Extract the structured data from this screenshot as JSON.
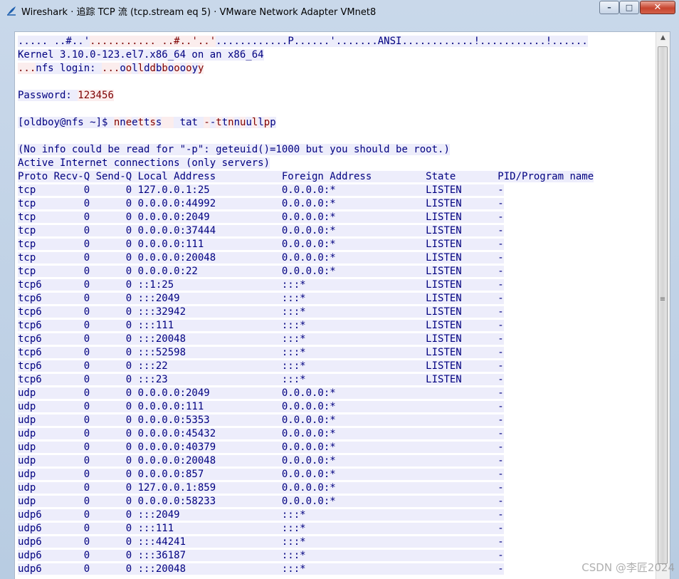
{
  "window": {
    "title": "Wireshark · 追踪 TCP 流 (tcp.stream eq 5) · VMware Network Adapter VMnet8",
    "min_glyph": "–",
    "max_glyph": "□",
    "close_glyph": "✕"
  },
  "colors": {
    "client_text": "#7e0001",
    "client_bg": "#fbeded",
    "server_text": "#000080",
    "server_bg": "#ededfb"
  },
  "segments": [
    {
      "side": "srv",
      "text": "..... ..#..'"
    },
    {
      "side": "cli",
      "text": "........... ..#..'..'"
    },
    {
      "side": "srv",
      "text": "............P......'.......ANSI............!...........!......"
    },
    {
      "side": "brk",
      "text": ""
    },
    {
      "side": "srv",
      "text": "Kernel 3.10.0-123.el7.x86_64 on an x86_64"
    },
    {
      "side": "brk",
      "text": ""
    },
    {
      "side": "cli",
      "text": "..."
    },
    {
      "side": "srv",
      "text": "nfs login: "
    },
    {
      "side": "cli",
      "text": "..."
    },
    {
      "side": "srv",
      "text": "o"
    },
    {
      "side": "cli",
      "text": "o"
    },
    {
      "side": "srv",
      "text": "l"
    },
    {
      "side": "cli",
      "text": "l"
    },
    {
      "side": "srv",
      "text": "d"
    },
    {
      "side": "cli",
      "text": "d"
    },
    {
      "side": "srv",
      "text": "b"
    },
    {
      "side": "cli",
      "text": "b"
    },
    {
      "side": "srv",
      "text": "o"
    },
    {
      "side": "cli",
      "text": "o"
    },
    {
      "side": "srv",
      "text": "o"
    },
    {
      "side": "cli",
      "text": "o"
    },
    {
      "side": "srv",
      "text": "y"
    },
    {
      "side": "cli",
      "text": "y"
    },
    {
      "side": "brk",
      "text": ""
    },
    {
      "side": "brk",
      "text": ""
    },
    {
      "side": "srv",
      "text": "Password: "
    },
    {
      "side": "cli",
      "text": "123456"
    },
    {
      "side": "brk",
      "text": ""
    },
    {
      "side": "brk",
      "text": ""
    },
    {
      "side": "srv",
      "text": "[oldboy@nfs ~]$ "
    },
    {
      "side": "cli",
      "text": "n"
    },
    {
      "side": "srv",
      "text": "n"
    },
    {
      "side": "cli",
      "text": "e"
    },
    {
      "side": "srv",
      "text": "e"
    },
    {
      "side": "cli",
      "text": "t"
    },
    {
      "side": "srv",
      "text": "t"
    },
    {
      "side": "cli",
      "text": "s"
    },
    {
      "side": "srv",
      "text": "s"
    },
    {
      "side": "cli",
      "text": "  "
    },
    {
      "side": "srv",
      "text": " tat "
    },
    {
      "side": "cli",
      "text": "-"
    },
    {
      "side": "srv",
      "text": "-"
    },
    {
      "side": "cli",
      "text": "t"
    },
    {
      "side": "srv",
      "text": "t"
    },
    {
      "side": "cli",
      "text": "n"
    },
    {
      "side": "srv",
      "text": "n"
    },
    {
      "side": "cli",
      "text": "u"
    },
    {
      "side": "srv",
      "text": "u"
    },
    {
      "side": "cli",
      "text": "l"
    },
    {
      "side": "srv",
      "text": "l"
    },
    {
      "side": "cli",
      "text": "p"
    },
    {
      "side": "srv",
      "text": "p"
    },
    {
      "side": "brk",
      "text": ""
    },
    {
      "side": "brk",
      "text": ""
    },
    {
      "side": "srv",
      "text": "(No info could be read for \"-p\": geteuid()=1000 but you should be root.)"
    },
    {
      "side": "brk",
      "text": ""
    },
    {
      "side": "srv",
      "text": "Active Internet connections (only servers)"
    },
    {
      "side": "brk",
      "text": ""
    },
    {
      "side": "srv",
      "text": "Proto Recv-Q Send-Q Local Address           Foreign Address         State       PID/Program name"
    },
    {
      "side": "brk",
      "text": ""
    },
    {
      "side": "srv",
      "text": "tcp        0      0 127.0.0.1:25            0.0.0.0:*               LISTEN      -"
    },
    {
      "side": "brk",
      "text": ""
    },
    {
      "side": "srv",
      "text": "tcp        0      0 0.0.0.0:44992           0.0.0.0:*               LISTEN      -"
    },
    {
      "side": "brk",
      "text": ""
    },
    {
      "side": "srv",
      "text": "tcp        0      0 0.0.0.0:2049            0.0.0.0:*               LISTEN      -"
    },
    {
      "side": "brk",
      "text": ""
    },
    {
      "side": "srv",
      "text": "tcp        0      0 0.0.0.0:37444           0.0.0.0:*               LISTEN      -"
    },
    {
      "side": "brk",
      "text": ""
    },
    {
      "side": "srv",
      "text": "tcp        0      0 0.0.0.0:111             0.0.0.0:*               LISTEN      -"
    },
    {
      "side": "brk",
      "text": ""
    },
    {
      "side": "srv",
      "text": "tcp        0      0 0.0.0.0:20048           0.0.0.0:*               LISTEN      -"
    },
    {
      "side": "brk",
      "text": ""
    },
    {
      "side": "srv",
      "text": "tcp        0      0 0.0.0.0:22              0.0.0.0:*               LISTEN      -"
    },
    {
      "side": "brk",
      "text": ""
    },
    {
      "side": "srv",
      "text": "tcp6       0      0 ::1:25                  :::*                    LISTEN      -"
    },
    {
      "side": "brk",
      "text": ""
    },
    {
      "side": "srv",
      "text": "tcp6       0      0 :::2049                 :::*                    LISTEN      -"
    },
    {
      "side": "brk",
      "text": ""
    },
    {
      "side": "srv",
      "text": "tcp6       0      0 :::32942                :::*                    LISTEN      -"
    },
    {
      "side": "brk",
      "text": ""
    },
    {
      "side": "srv",
      "text": "tcp6       0      0 :::111                  :::*                    LISTEN      -"
    },
    {
      "side": "brk",
      "text": ""
    },
    {
      "side": "srv",
      "text": "tcp6       0      0 :::20048                :::*                    LISTEN      -"
    },
    {
      "side": "brk",
      "text": ""
    },
    {
      "side": "srv",
      "text": "tcp6       0      0 :::52598                :::*                    LISTEN      -"
    },
    {
      "side": "brk",
      "text": ""
    },
    {
      "side": "srv",
      "text": "tcp6       0      0 :::22                   :::*                    LISTEN      -"
    },
    {
      "side": "brk",
      "text": ""
    },
    {
      "side": "srv",
      "text": "tcp6       0      0 :::23                   :::*                    LISTEN      -"
    },
    {
      "side": "brk",
      "text": ""
    },
    {
      "side": "srv",
      "text": "udp        0      0 0.0.0.0:2049            0.0.0.0:*                           -"
    },
    {
      "side": "brk",
      "text": ""
    },
    {
      "side": "srv",
      "text": "udp        0      0 0.0.0.0:111             0.0.0.0:*                           -"
    },
    {
      "side": "brk",
      "text": ""
    },
    {
      "side": "srv",
      "text": "udp        0      0 0.0.0.0:5353            0.0.0.0:*                           -"
    },
    {
      "side": "brk",
      "text": ""
    },
    {
      "side": "srv",
      "text": "udp        0      0 0.0.0.0:45432           0.0.0.0:*                           -"
    },
    {
      "side": "brk",
      "text": ""
    },
    {
      "side": "srv",
      "text": "udp        0      0 0.0.0.0:40379           0.0.0.0:*                           -"
    },
    {
      "side": "brk",
      "text": ""
    },
    {
      "side": "srv",
      "text": "udp        0      0 0.0.0.0:20048           0.0.0.0:*                           -"
    },
    {
      "side": "brk",
      "text": ""
    },
    {
      "side": "srv",
      "text": "udp        0      0 0.0.0.0:857             0.0.0.0:*                           -"
    },
    {
      "side": "brk",
      "text": ""
    },
    {
      "side": "srv",
      "text": "udp        0      0 127.0.0.1:859           0.0.0.0:*                           -"
    },
    {
      "side": "brk",
      "text": ""
    },
    {
      "side": "srv",
      "text": "udp        0      0 0.0.0.0:58233           0.0.0.0:*                           -"
    },
    {
      "side": "brk",
      "text": ""
    },
    {
      "side": "srv",
      "text": "udp6       0      0 :::2049                 :::*                                -"
    },
    {
      "side": "brk",
      "text": ""
    },
    {
      "side": "srv",
      "text": "udp6       0      0 :::111                  :::*                                -"
    },
    {
      "side": "brk",
      "text": ""
    },
    {
      "side": "srv",
      "text": "udp6       0      0 :::44241                :::*                                -"
    },
    {
      "side": "brk",
      "text": ""
    },
    {
      "side": "srv",
      "text": "udp6       0      0 :::36187                :::*                                -"
    },
    {
      "side": "brk",
      "text": ""
    },
    {
      "side": "srv",
      "text": "udp6       0      0 :::20048                :::*                                -"
    },
    {
      "side": "brk",
      "text": ""
    }
  ],
  "scrollbar": {
    "up_glyph": "▲",
    "grip_glyph": "≡"
  },
  "watermark": "CSDN @李匠2024"
}
